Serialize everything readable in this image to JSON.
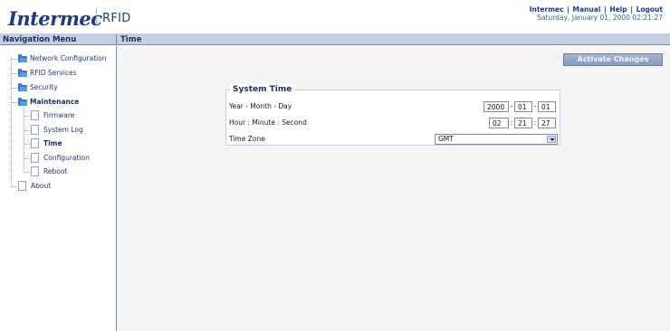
{
  "header": {
    "brand": "Intermec",
    "product": "RFID",
    "links": [
      "Intermec",
      "Manual",
      "Help",
      "Logout"
    ],
    "datetime": "Saturday, January 01, 2000 02:21:27"
  },
  "nav": {
    "title": "Navigation Menu",
    "items": [
      {
        "label": "Network Configuration",
        "icon": "folder-icon"
      },
      {
        "label": "RFID Services",
        "icon": "folder-icon"
      },
      {
        "label": "Security",
        "icon": "folder-icon"
      },
      {
        "label": "Maintenance",
        "icon": "folder-icon"
      },
      {
        "label": "Firmware",
        "icon": "page-icon"
      },
      {
        "label": "System Log",
        "icon": "page-icon"
      },
      {
        "label": "Time",
        "icon": "page-icon"
      },
      {
        "label": "Configuration",
        "icon": "page-icon"
      },
      {
        "label": "Reboot",
        "icon": "page-icon"
      },
      {
        "label": "About",
        "icon": "page-icon"
      }
    ]
  },
  "content": {
    "title": "Time",
    "activate_button": "Activate Changes",
    "system_time": {
      "legend": "System Time",
      "date_label": "Year - Month - Day",
      "year": "2000",
      "month": "01",
      "day": "01",
      "time_label": "Hour : Minute : Second",
      "hour": "02",
      "minute": "21",
      "second": "27",
      "timezone_label": "Time Zone",
      "timezone_value": "GMT"
    }
  },
  "colors": {
    "brand": "#1c3a8c",
    "titlebar": "#c3cfe3",
    "button": "#8a9abc"
  }
}
